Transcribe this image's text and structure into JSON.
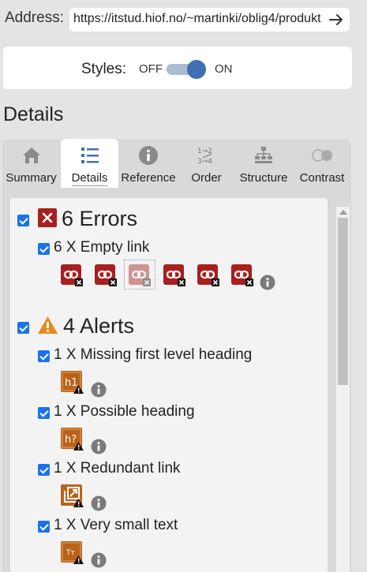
{
  "address": {
    "label": "Address:",
    "url": "https://itstud.hiof.no/~martinki/oblig4/produkt"
  },
  "styles": {
    "label": "Styles:",
    "off_label": "OFF",
    "on_label": "ON",
    "state": "on"
  },
  "page_title": "Details",
  "tabs": [
    {
      "label": "Summary",
      "icon": "home-icon"
    },
    {
      "label": "Details",
      "icon": "list-icon",
      "active": true
    },
    {
      "label": "Reference",
      "icon": "info-icon"
    },
    {
      "label": "Order",
      "icon": "order-icon"
    },
    {
      "label": "Structure",
      "icon": "hierarchy-icon"
    },
    {
      "label": "Contrast",
      "icon": "contrast-icon"
    }
  ],
  "errors": {
    "heading": "6 Errors",
    "items": [
      {
        "label": "6 X Empty link",
        "icon_count": 6
      }
    ]
  },
  "alerts": {
    "heading": "4 Alerts",
    "items": [
      {
        "label": "1 X Missing first level heading",
        "icon_text": "h1"
      },
      {
        "label": "1 X Possible heading",
        "icon_text": "h?"
      },
      {
        "label": "1 X Redundant link",
        "icon_text": ""
      },
      {
        "label": "1 X Very small text",
        "icon_text": "Tт"
      }
    ]
  },
  "colors": {
    "error": "#a81f1f",
    "alert_icon": "#b8631b",
    "alert_triangle": "#e58a1f",
    "checkbox": "#1a73e8",
    "toggle_knob": "#3f6fb5"
  }
}
